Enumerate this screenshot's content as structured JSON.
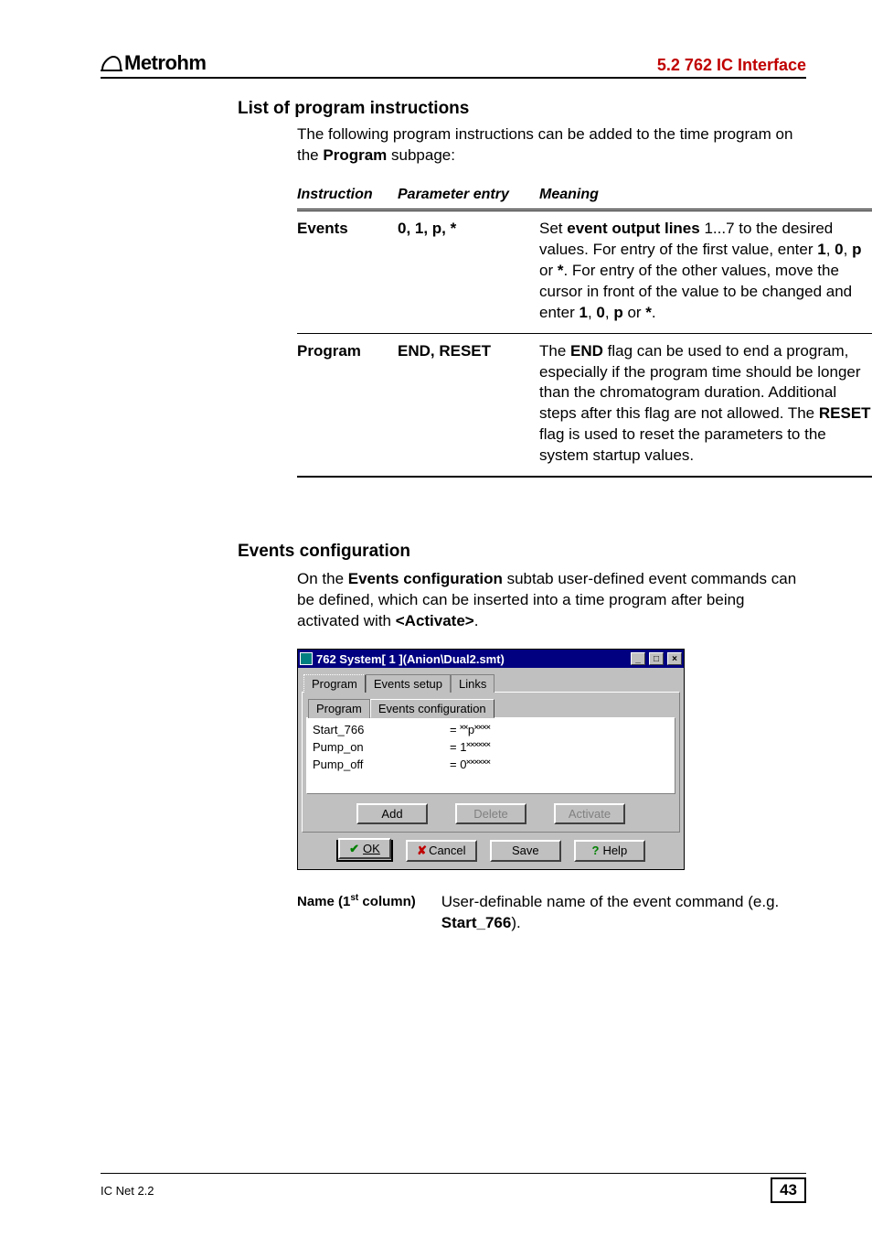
{
  "header": {
    "brand": "Metrohm",
    "section": "5.2  762 IC Interface"
  },
  "headings": {
    "list": "List of program instructions",
    "events": "Events configuration"
  },
  "intro": {
    "p1a": "The following program instructions can be added to the time program on the ",
    "p1_bold": "Program",
    "p1b": " subpage:"
  },
  "table": {
    "head": {
      "instruction": "Instruction",
      "param": "Parameter entry",
      "meaning": "Meaning"
    },
    "rows": [
      {
        "instruction": "Events",
        "param": "0, 1, p, *",
        "meaning_parts": {
          "a": "Set ",
          "b": "event output lines",
          "c": " 1...7 to the desired values. For entry of the first value, enter ",
          "d": "1",
          "e": ", ",
          "f": "0",
          "g": ", ",
          "h": "p",
          "i": " or ",
          "j": "*",
          "k": ". For entry of the other values, move the cursor in front of the value to be changed and enter ",
          "l": "1",
          "m": ", ",
          "n": "0",
          "o": ", ",
          "p": "p",
          "q": " or ",
          "r": "*",
          "s": "."
        }
      },
      {
        "instruction": "Program",
        "param": "END, RESET",
        "meaning_parts": {
          "a": "The ",
          "b": "END",
          "c": " flag can be used to end a program, especially if the program time should be longer than the chromatogram duration. Additional steps after this flag are not allowed. The ",
          "d": "RESET",
          "e": " flag is used to reset the parameters to the system startup values."
        }
      }
    ]
  },
  "events_intro": {
    "a": "On the ",
    "b": "Events configuration",
    "c": " subtab user-defined event commands can be defined, which can be inserted into a time program after being activated with ",
    "d": "<Activate>",
    "e": "."
  },
  "window": {
    "title": "762 System[ 1 ](Anion\\Dual2.smt)",
    "tabs": [
      "Program",
      "Events setup",
      "Links"
    ],
    "subtabs": [
      "Program",
      "Events configuration"
    ],
    "events": [
      {
        "name": "Start_766",
        "value": "= ˟˟p˟˟˟˟"
      },
      {
        "name": "Pump_on",
        "value": "= 1˟˟˟˟˟˟"
      },
      {
        "name": "Pump_off",
        "value": "= 0˟˟˟˟˟˟"
      }
    ],
    "buttons": {
      "add": "Add",
      "delete": "Delete",
      "activate": "Activate"
    },
    "dlg": {
      "ok": "OK",
      "cancel": "Cancel",
      "save": "Save",
      "help": "Help"
    }
  },
  "def": {
    "term_a": "Name (1",
    "term_sup": "st",
    "term_b": " column)",
    "body_a": "User-definable name of the event command (e.g. ",
    "body_b": "Start_766",
    "body_c": ")."
  },
  "footer": {
    "left": "IC Net 2.2",
    "page": "43"
  }
}
